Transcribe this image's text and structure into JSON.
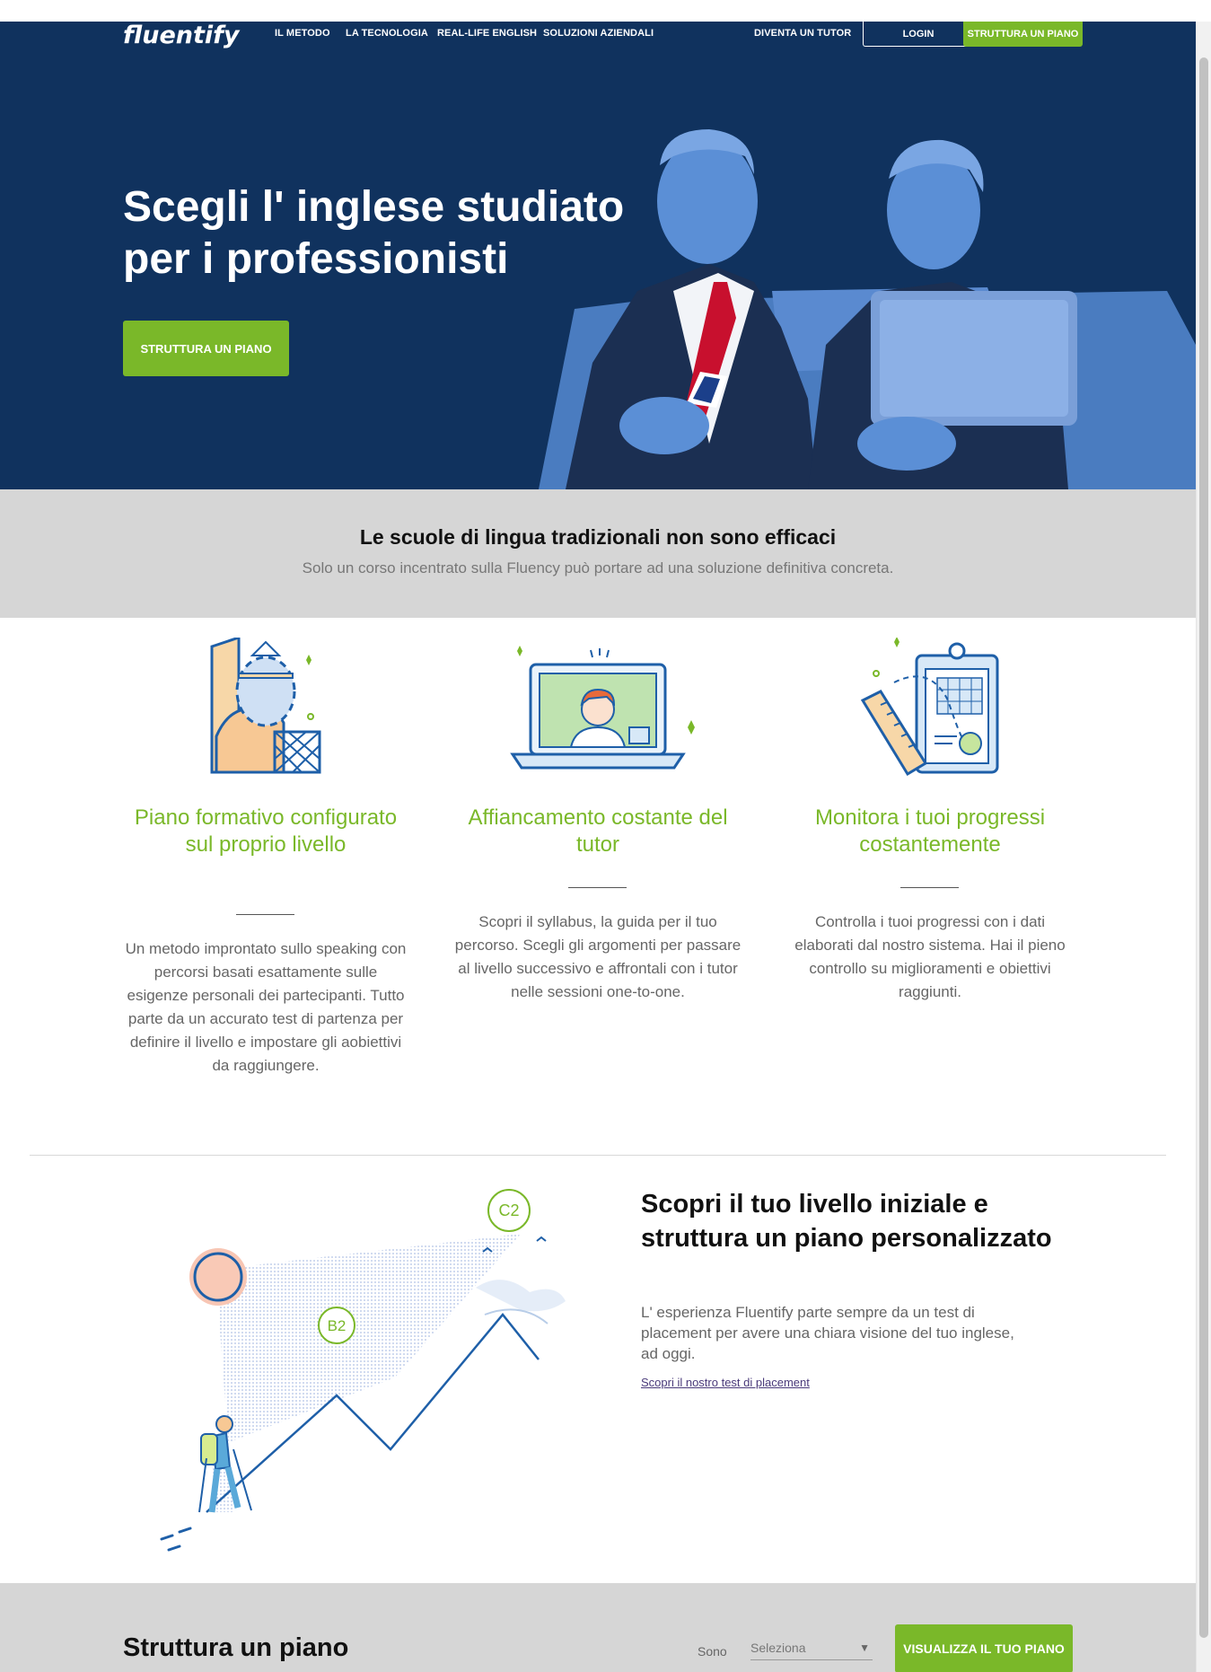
{
  "nav": {
    "logo": "fluentify",
    "links": [
      "IL METODO",
      "LA TECNOLOGIA",
      "REAL-LIFE ENGLISH",
      "SOLUZIONI AZIENDALI"
    ],
    "tutor": "DIVENTA UN TUTOR",
    "login": "LOGIN",
    "cta": "STRUTTURA UN PIANO"
  },
  "hero": {
    "title_line1": "Scegli l' inglese studiato",
    "title_line2": "per i professionisti",
    "cta": "STRUTTURA UN PIANO"
  },
  "band": {
    "title": "Le scuole di lingua tradizionali non sono efficaci",
    "subtitle": "Solo un corso incentrato sulla Fluency può portare ad una soluzione definitiva concreta."
  },
  "features": [
    {
      "title": "Piano formativo configurato sul proprio livello",
      "text": "Un metodo improntato sullo speaking con percorsi basati esattamente sulle esigenze personali dei partecipanti. Tutto parte da un accurato test di partenza per definire il livello e impostare gli aobiettivi da raggiungere."
    },
    {
      "title": "Affiancamento costante del tutor",
      "text": "Scopri il syllabus, la guida per il tuo percorso. Scegli gli argomenti per passare al livello successivo e affrontali con i tutor nelle sessioni one-to-one."
    },
    {
      "title": "Monitora i tuoi progressi costantemente",
      "text": "Controlla i tuoi progressi con i dati elaborati dal nostro sistema. Hai il pieno controllo su miglioramenti e obiettivi raggiunti."
    }
  ],
  "placement": {
    "title": "Scopri il tuo livello iniziale e struttura un piano personalizzato",
    "text": "L' esperienza Fluentify parte sempre da un test di placement per avere una chiara visione del tuo inglese, ad oggi.",
    "link": "Scopri il nostro test di placement",
    "level_low": "B2",
    "level_high": "C2"
  },
  "plan": {
    "title": "Struttura un piano",
    "label": "Sono",
    "select_value": "Seleziona",
    "cta": "VISUALIZZA IL TUO PIANO"
  },
  "colors": {
    "navy": "#10325e",
    "green": "#7ab829",
    "gray_band": "#d6d6d6",
    "hero_figure_blue": "#5b8fd6"
  }
}
